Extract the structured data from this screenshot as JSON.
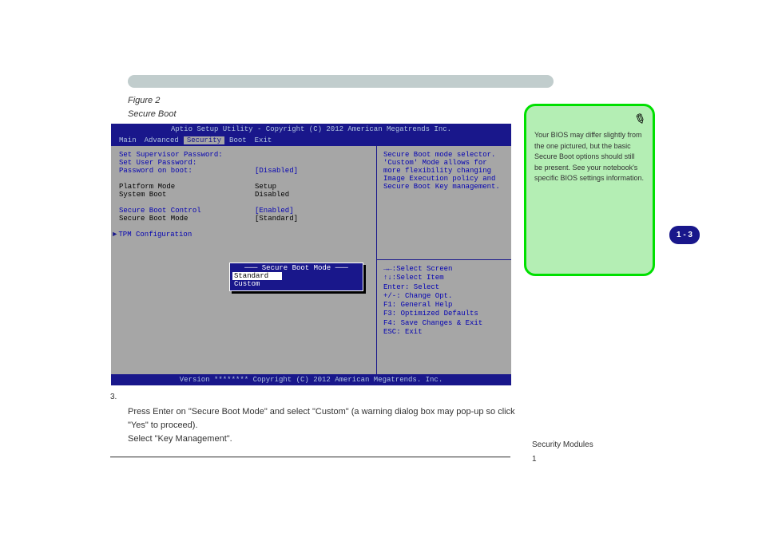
{
  "note_bar": "",
  "figure_caption": "Figure 2",
  "figure_subcaption": "Secure Boot",
  "bios": {
    "header": "Aptio Setup Utility - Copyright (C) 2012 American Megatrends Inc.",
    "tabs": [
      "Main",
      "Advanced",
      "Security",
      "Boot",
      "Exit"
    ],
    "selected_tab": "Security",
    "left_rows": [
      {
        "label": "Set Supervisor Password:",
        "value": "",
        "cls": ""
      },
      {
        "label": "Set User Password:",
        "value": "",
        "cls": ""
      },
      {
        "label": "Password on boot:",
        "value": "[Disabled]",
        "cls": ""
      },
      {
        "label": "",
        "value": "",
        "cls": ""
      },
      {
        "label": "Platform Mode",
        "value": "Setup",
        "cls": "black"
      },
      {
        "label": "System Boot",
        "value": "Disabled",
        "cls": "black"
      },
      {
        "label": "",
        "value": "",
        "cls": ""
      },
      {
        "label": "Secure Boot Control",
        "value": "[Enabled]",
        "cls": ""
      },
      {
        "label": "Secure Boot Mode",
        "value": "[Standard]",
        "cls": "black"
      },
      {
        "label": "",
        "value": "",
        "cls": ""
      },
      {
        "label": "TPM Configuration",
        "value": "",
        "cls": "",
        "marker": "►"
      }
    ],
    "help": "Secure Boot mode selector. 'Custom' Mode allows for more flexibility changing Image Execution policy and Secure Boot Key management.",
    "keys": [
      "→←:Select Screen",
      "↑↓:Select Item",
      "Enter: Select",
      "+/-: Change Opt.",
      "F1: General Help",
      "F3: Optimized Defaults",
      "F4: Save Changes & Exit",
      "ESC: Exit"
    ],
    "popup": {
      "title": "Secure Boot Mode",
      "items": [
        "Standard",
        "Custom"
      ],
      "selected": "Standard"
    },
    "footer": "Version ******** Copyright (C) 2012 American Megatrends. Inc."
  },
  "side_note": "Your BIOS may differ slightly from the one pictured, but the basic Secure Boot options should still be present. See your notebook's specific BIOS settings information.",
  "page_num": "1 - 3",
  "section_num": "3.",
  "body1": "Press Enter on \"Secure Boot Mode\" and select \"Custom\" (a warning dialog box may pop-up so click \"Yes\" to proceed).",
  "body2": "Select \"Key Management\".",
  "section_label_1": "Security Modules",
  "section_label_2": "1"
}
